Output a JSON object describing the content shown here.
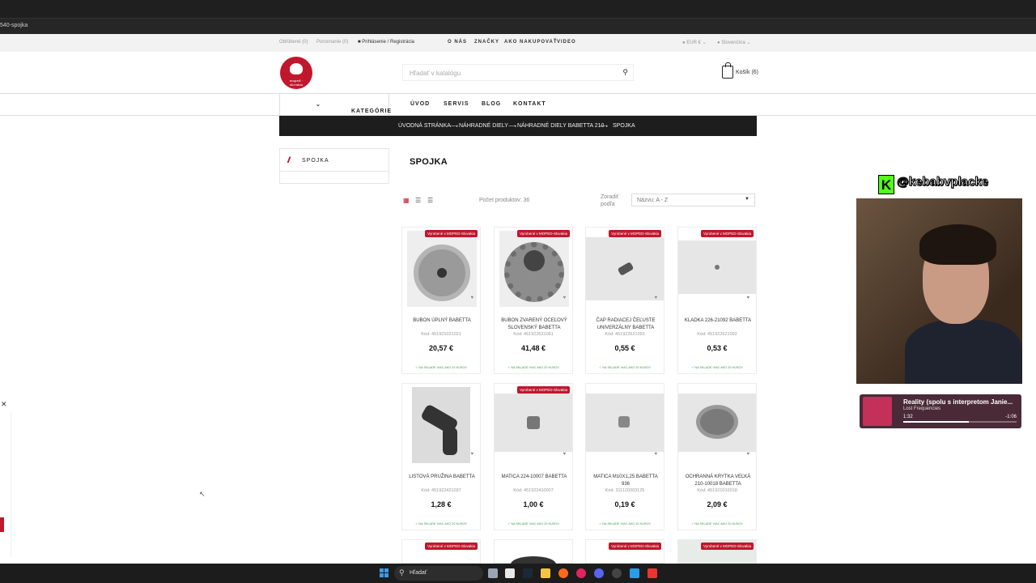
{
  "browser": {
    "url_fragment": "540-spojka"
  },
  "topbar": {
    "oblubene": "Obľúbené (0)",
    "porovnanie": "Porovnanie (0)",
    "login": "Prihlásenie / Registrácia",
    "menu": [
      "O NÁS",
      "ZNAČKY",
      "AKO NAKUPOVAŤ",
      "VIDEO"
    ],
    "currency": "EUR €",
    "language": "Slovenčina"
  },
  "header": {
    "logo_text": "moped - slovakia",
    "search_placeholder": "Hľadať v katalógu",
    "cart_label": "Košík (6)"
  },
  "nav": {
    "categories": "KATEGÓRIE",
    "items": [
      "ÚVOD",
      "SERVIS",
      "BLOG",
      "KONTAKT"
    ]
  },
  "breadcrumb": [
    "ÚVODNÁ STRÁNKA",
    "NÁHRADNÉ DIELY",
    "NÁHRADNÉ DIELY BABETTA 210",
    "SPOJKA"
  ],
  "sidebar": {
    "title": "SPOJKA"
  },
  "page_title": "SPOJKA",
  "toolbar": {
    "count": "Počet produktov: 36",
    "sort_label": "Zoradiť podľa",
    "sort_value": "Názvu: A - Z"
  },
  "products": [
    {
      "name": "BUBON ÚPLNÝ BABETTA",
      "code": "Kód: 451921021021",
      "price": "20,57 €",
      "badge": "Vyrobené v MOPED-Slovakia",
      "stock": "NA SKLADE VIAC AKO 20 KUSOV"
    },
    {
      "name": "BUBON ZVARENÝ OCEĽOVÝ SLOVENSKÝ BABETTA",
      "code": "Kód: 451922621061",
      "price": "41,48 €",
      "badge": "Vyrobené v MOPED-Slovakia",
      "stock": "NA SKLADE VIAC AKO 20 KUSOV"
    },
    {
      "name": "ČAP RADIACEJ ČEĽUSTE UNIVERZÁLNY BABETTA",
      "code": "Kód: 451922621091",
      "price": "0,55 €",
      "badge": "Vyrobené v MOPED-Slovakia",
      "stock": "NA SKLADE VIAC AKO 20 KUSOV"
    },
    {
      "name": "KLADKA 226-21092 BABETTA",
      "code": "Kód: 451922621092",
      "price": "0,53 €",
      "badge": "Vyrobené v MOPED-Slovakia",
      "stock": "NA SKLADE VIAC AKO 20 KUSOV"
    },
    {
      "name": "LISTOVÁ PRUŽINA BABETTA",
      "code": "Kód: 451922421037",
      "price": "1,28 €",
      "badge": "",
      "stock": "NA SKLADE VIAC AKO 20 KUSOV"
    },
    {
      "name": "MATICA 224-10007 BABETTA",
      "code": "Kód: 451922410007",
      "price": "1,00 €",
      "badge": "Vyrobené v MOPED-Slovakia",
      "stock": "NA SKLADE VIAC AKO 20 KUSOV"
    },
    {
      "name": "MATICA M10X1,25 BABETTA 936",
      "code": "Kód: 311120303125",
      "price": "0,19 €",
      "badge": "",
      "stock": "NA SKLADE VIAC AKO 20 KUSOV"
    },
    {
      "name": "OCHRANNÁ KRYTKA VEĽKÁ 210-10018 BABETTA",
      "code": "Kód: 451921010018",
      "price": "2,09 €",
      "badge": "",
      "stock": "NA SKLADE VIAC AKO 20 KUSOV"
    }
  ],
  "row3_badges": [
    "Vyrobené v MOPED-Slovakia",
    "",
    "Vyrobené v MOPED-Slovakia",
    "Vyrobené v MOPED-Slovakia"
  ],
  "stream": {
    "channel": "@kebabvplacke",
    "song_title": "Reality (spolu s interpretom Janie...",
    "artist": "Lost Frequencies",
    "time_elapsed": "1:32",
    "time_remaining": "-1:06",
    "progress": 0.58
  },
  "taskbar": {
    "search": "Hľadať"
  },
  "colors": {
    "brand": "#c0172d",
    "breadcrumb_bg": "#1d1d1d",
    "stock_green": "#3a9a4a"
  }
}
